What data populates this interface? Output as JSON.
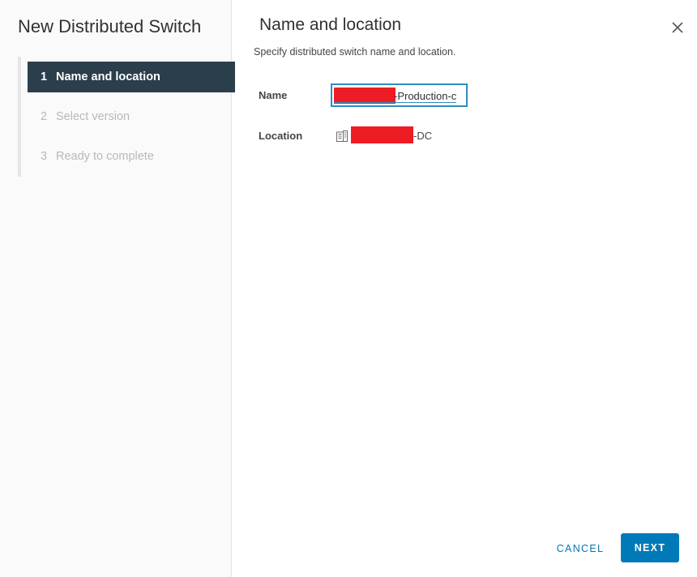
{
  "wizard": {
    "title": "New Distributed Switch",
    "steps": [
      {
        "number": "1",
        "label": "Name and location",
        "state": "active"
      },
      {
        "number": "2",
        "label": "Select version",
        "state": "disabled"
      },
      {
        "number": "3",
        "label": "Ready to complete",
        "state": "disabled"
      }
    ]
  },
  "page": {
    "title": "Name and location",
    "subtitle": "Specify distributed switch name and location.",
    "close_icon": "close-icon"
  },
  "form": {
    "name_label": "Name",
    "name_value_visible": "-Production-c",
    "location_label": "Location",
    "location_icon": "datacenter-icon",
    "location_value_visible": "-DC"
  },
  "footer": {
    "cancel_label": "CANCEL",
    "next_label": "NEXT"
  },
  "colors": {
    "accent": "#0079b8",
    "active_step_bg": "#2b3e4c",
    "redaction": "#ee1c25"
  }
}
